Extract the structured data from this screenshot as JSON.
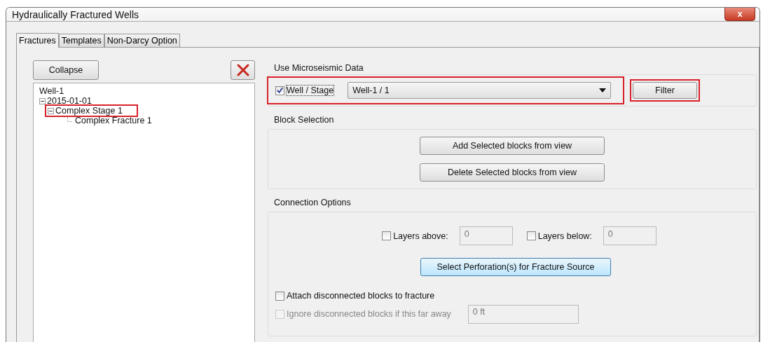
{
  "window": {
    "title": "Hydraulically Fractured Wells",
    "close": "x"
  },
  "tabs": [
    {
      "label": "Fractures",
      "selected": true
    },
    {
      "label": "Templates",
      "selected": false
    },
    {
      "label": "Non-Darcy Option",
      "selected": false
    }
  ],
  "tree_panel": {
    "collapse_button": "Collapse",
    "tree": [
      {
        "label": "Well-1",
        "highlighted": false,
        "children": [
          {
            "label": "2015-01-01",
            "expanded": true,
            "highlighted": false,
            "children": [
              {
                "label": "Complex Stage 1",
                "expanded": true,
                "highlighted": true,
                "children": [
                  {
                    "label": "Complex Fracture 1",
                    "highlighted": false
                  }
                ]
              }
            ]
          }
        ]
      }
    ]
  },
  "microseismic": {
    "title": "Use Microseismic Data",
    "checkbox_label": "Well / Stage",
    "checked": true,
    "highlighted": true,
    "dropdown_value": "Well-1 / 1",
    "filter_button": "Filter",
    "filter_highlighted": true
  },
  "block_selection": {
    "title": "Block Selection",
    "buttons": [
      "Add Selected blocks from view",
      "Delete Selected blocks from view"
    ]
  },
  "connection_options": {
    "title": "Connection Options",
    "layers": [
      {
        "label": "Layers above:",
        "checked": false,
        "value": "0"
      },
      {
        "label": "Layers below:",
        "checked": false,
        "value": "0"
      }
    ],
    "perforation_button": "Select Perforation(s) for Fracture Source",
    "options": [
      {
        "label": "Attach disconnected blocks to fracture",
        "checked": false,
        "disabled": false
      },
      {
        "label": "Ignore disconnected blocks if this far away",
        "checked": false,
        "disabled": true,
        "value": "0 ft"
      }
    ]
  }
}
